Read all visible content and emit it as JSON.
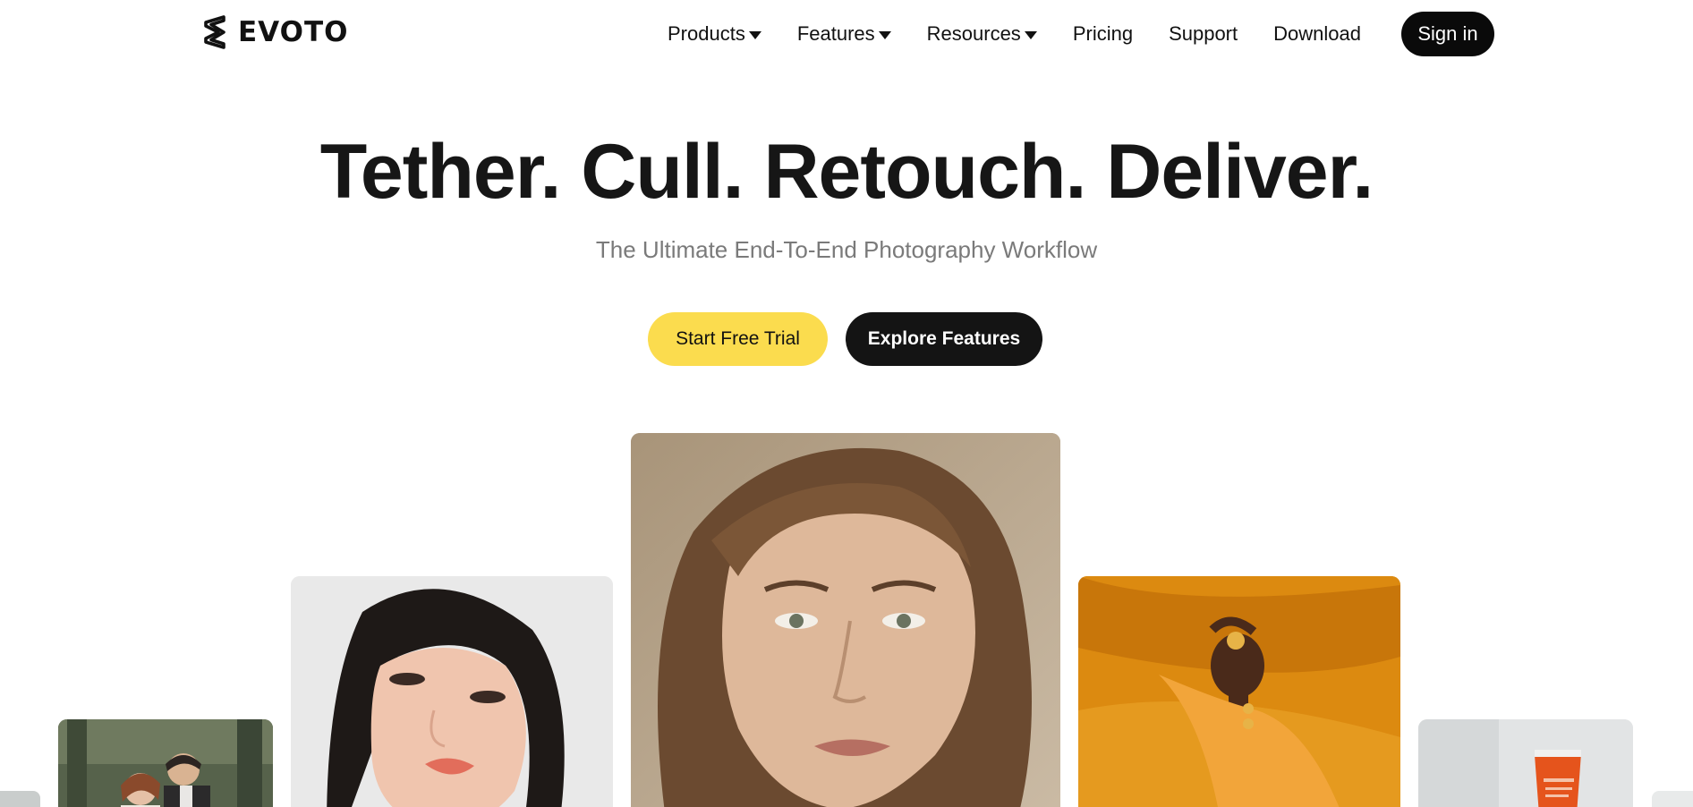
{
  "brand": {
    "name": "EVOTO"
  },
  "nav": {
    "items": [
      {
        "label": "Products",
        "has_dropdown": true
      },
      {
        "label": "Features",
        "has_dropdown": true
      },
      {
        "label": "Resources",
        "has_dropdown": true
      },
      {
        "label": "Pricing",
        "has_dropdown": false
      },
      {
        "label": "Support",
        "has_dropdown": false
      },
      {
        "label": "Download",
        "has_dropdown": false
      }
    ],
    "signin_label": "Sign in"
  },
  "hero": {
    "title": "Tether. Cull. Retouch. Deliver.",
    "subtitle": "The Ultimate End-To-End Photography Workflow",
    "primary_cta": "Start Free Trial",
    "secondary_cta": "Explore Features"
  },
  "gallery": {
    "cards": [
      {
        "subject": "couple-outdoor-photo"
      },
      {
        "subject": "asian-woman-portrait"
      },
      {
        "subject": "woman-closeup-portrait"
      },
      {
        "subject": "woman-orange-fabric-portrait"
      },
      {
        "subject": "skincare-product-photo"
      }
    ]
  },
  "colors": {
    "accent_yellow": "#fbdc4e",
    "dark": "#141414",
    "subtitle_gray": "#7a7a7a"
  }
}
